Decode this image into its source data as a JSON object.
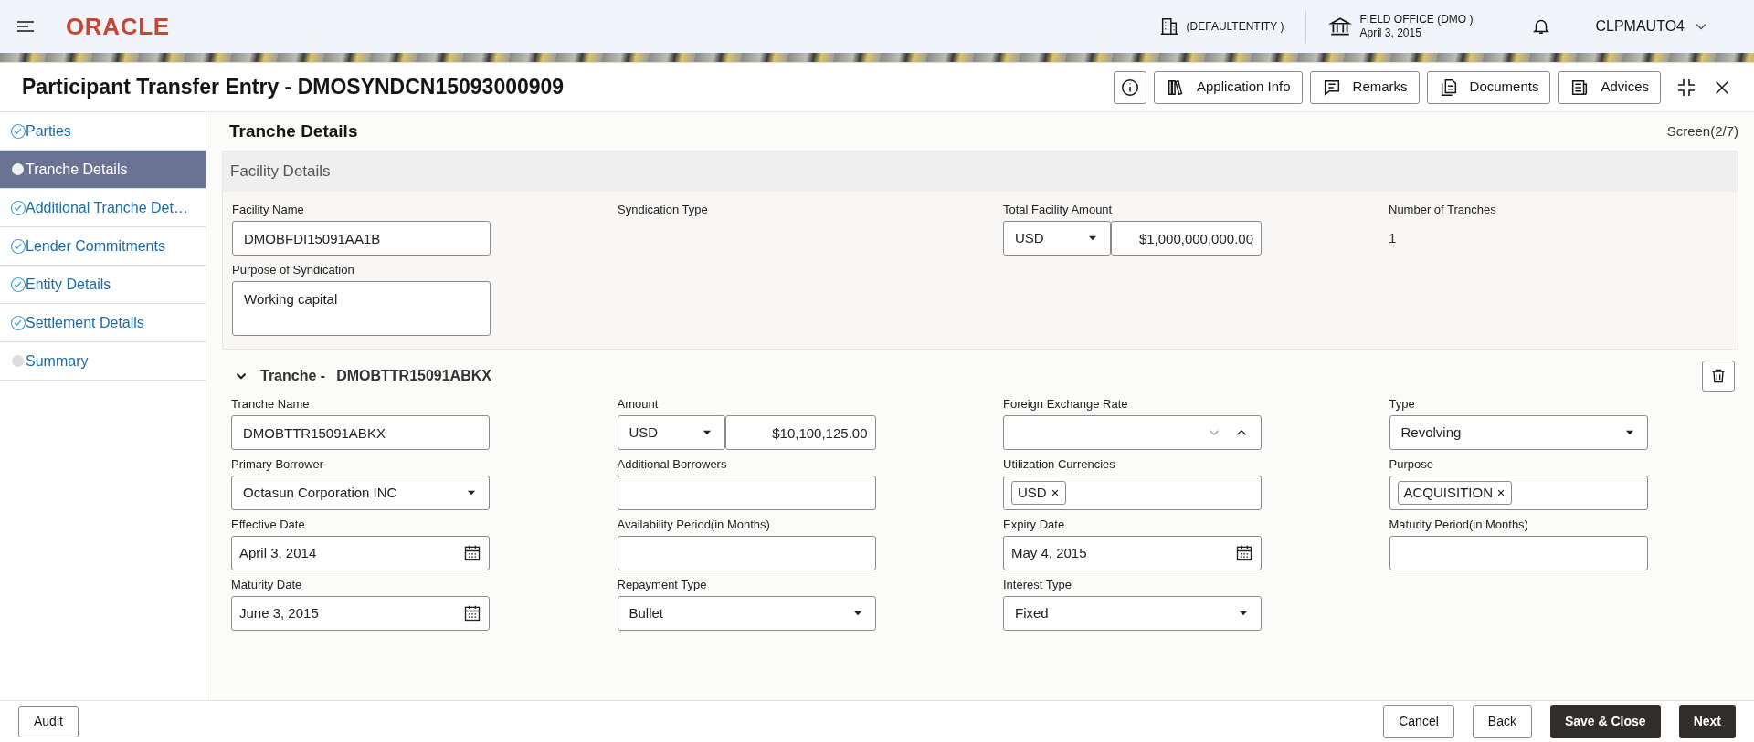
{
  "header": {
    "logo": "ORACLE",
    "entity": "(DEFAULTENTITY )",
    "office": "FIELD OFFICE (DMO )",
    "date": "April 3, 2015",
    "user": "CLPMAUTO4"
  },
  "window": {
    "title": "Participant Transfer Entry - DMOSYNDCN15093000909",
    "toolbar": [
      {
        "kind": "info"
      },
      {
        "kind": "appinfo",
        "label": "Application Info"
      },
      {
        "kind": "remarks",
        "label": "Remarks"
      },
      {
        "kind": "documents",
        "label": "Documents"
      },
      {
        "kind": "advices",
        "label": "Advices"
      }
    ]
  },
  "sidebar": {
    "items": [
      {
        "label": "Parties",
        "selected": false,
        "done": true
      },
      {
        "label": "Tranche Details",
        "selected": true,
        "done": false
      },
      {
        "label": "Additional Tranche Det…",
        "selected": false,
        "done": true
      },
      {
        "label": "Lender Commitments",
        "selected": false,
        "done": true
      },
      {
        "label": "Entity Details",
        "selected": false,
        "done": true
      },
      {
        "label": "Settlement Details",
        "selected": false,
        "done": true
      },
      {
        "label": "Summary",
        "selected": false,
        "done": false
      }
    ]
  },
  "page": {
    "title": "Tranche Details",
    "screen": "Screen(2/7)"
  },
  "facility": {
    "title": "Facility Details",
    "fields": [
      {
        "kind": "text",
        "label": "Facility Name",
        "value": "DMOBFDI15091AA1B"
      },
      {
        "kind": "plain",
        "label": "Syndication Type"
      },
      {
        "kind": "amount",
        "label": "Total Facility Amount",
        "currency": "USD",
        "value": "$1,000,000,000.00"
      },
      {
        "kind": "plain",
        "label": "Number of Tranches",
        "value": "1"
      },
      {
        "kind": "textarea",
        "label": "Purpose of Syndication",
        "value": "Working capital"
      }
    ]
  },
  "tranche": {
    "title": "Tranche -",
    "id": "DMOBTTR15091ABKX",
    "expanded": true,
    "fields": [
      {
        "kind": "text",
        "label": "Tranche Name",
        "value": "DMOBTTR15091ABKX"
      },
      {
        "kind": "amount",
        "label": "Amount",
        "currency": "USD",
        "value": "$10,100,125.00"
      },
      {
        "kind": "combo",
        "label": "Foreign Exchange Rate"
      },
      {
        "kind": "select",
        "label": "Type",
        "value": "Revolving"
      },
      {
        "kind": "select",
        "label": "Primary Borrower",
        "value": "Octasun Corporation INC"
      },
      {
        "kind": "text",
        "label": "Additional Borrowers"
      },
      {
        "kind": "tags",
        "label": "Utilization Currencies",
        "tags": [
          "USD"
        ]
      },
      {
        "kind": "tags",
        "label": "Purpose",
        "tags": [
          "ACQUISITION"
        ]
      },
      {
        "kind": "date",
        "label": "Effective Date",
        "value": "April 3, 2014"
      },
      {
        "kind": "text",
        "label": "Availability Period(in Months)"
      },
      {
        "kind": "date",
        "label": "Expiry Date",
        "value": "May 4, 2015"
      },
      {
        "kind": "text",
        "label": "Maturity Period(in Months)"
      },
      {
        "kind": "date",
        "label": "Maturity Date",
        "value": "June 3, 2015"
      },
      {
        "kind": "select",
        "label": "Repayment Type",
        "value": "Bullet"
      },
      {
        "kind": "select",
        "label": "Interest Type",
        "value": "Fixed"
      }
    ]
  },
  "footer": {
    "left": [
      "Audit"
    ],
    "right": [
      {
        "label": "Cancel",
        "primary": false
      },
      {
        "label": "Back",
        "primary": false
      },
      {
        "label": "Save & Close",
        "primary": true
      },
      {
        "label": "Next",
        "primary": true
      }
    ]
  }
}
